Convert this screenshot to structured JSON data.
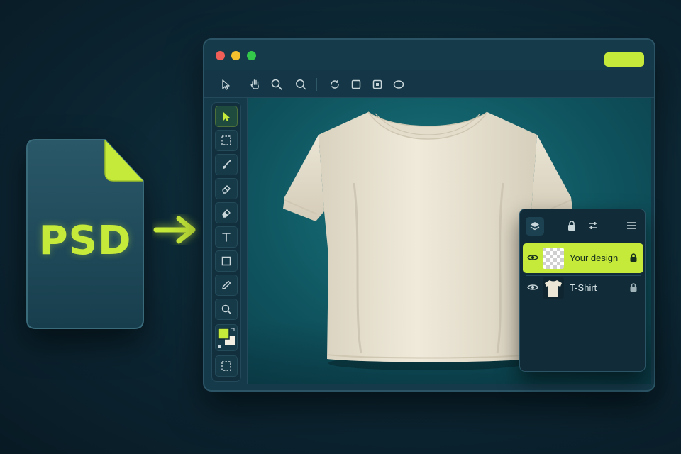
{
  "file_icon": {
    "label": "PSD",
    "accent": "#c6ea3a",
    "body": "#1e4656"
  },
  "colors": {
    "accent": "#c6ea3a",
    "window_bg": "#153a4a",
    "canvas_bg": "#0f5560",
    "background": "#0c2633"
  },
  "window": {
    "controls": [
      "close",
      "minimize",
      "zoom"
    ]
  },
  "toolbar": {
    "items": [
      "pointer-icon",
      "hand-icon",
      "zoom-icon",
      "lasso-icon",
      "rotate-icon",
      "rectangle-icon",
      "artboard-icon",
      "ellipse-icon"
    ]
  },
  "tools": {
    "items": [
      "move-tool",
      "marquee-tool",
      "brush-tool",
      "eraser-tool",
      "eraser-tool-2",
      "type-tool",
      "shape-tool",
      "eyedropper-tool",
      "zoom-tool"
    ],
    "foreground_color": "#c6ea3a",
    "background_color": "#f3efe2"
  },
  "canvas": {
    "subject": "t-shirt-mockup",
    "shirt_color": "#ece6d6"
  },
  "layers_panel": {
    "header_icons": [
      "layers-icon",
      "lock-icon",
      "adjustments-icon",
      "menu-icon"
    ],
    "layers": [
      {
        "name": "Your design",
        "visible": true,
        "locked": true,
        "selected": true
      },
      {
        "name": "T-Shirt",
        "visible": true,
        "locked": true,
        "selected": false
      }
    ]
  }
}
